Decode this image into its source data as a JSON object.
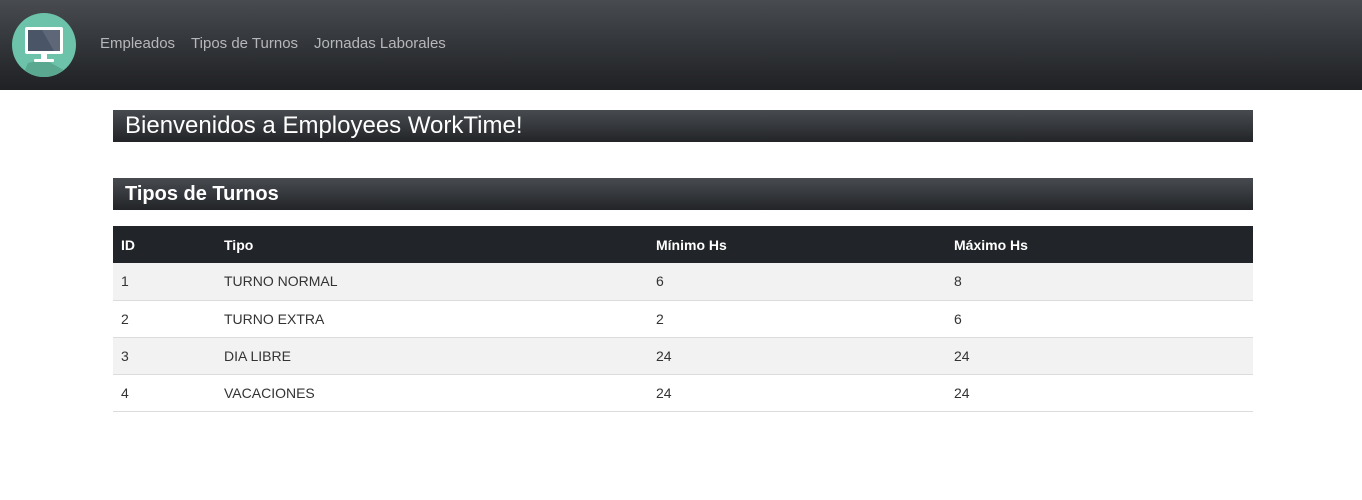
{
  "navbar": {
    "logo_icon": "monitor-icon",
    "links": [
      "Empleados",
      "Tipos de Turnos",
      "Jornadas Laborales"
    ]
  },
  "welcome": {
    "title": "Bienvenidos a Employees WorkTime!"
  },
  "section": {
    "title": "Tipos de Turnos"
  },
  "table": {
    "headers": [
      "ID",
      "Tipo",
      "Mínimo Hs",
      "Máximo Hs"
    ],
    "rows": [
      [
        "1",
        "TURNO NORMAL",
        "6",
        "8"
      ],
      [
        "2",
        "TURNO EXTRA",
        "2",
        "6"
      ],
      [
        "3",
        "DIA LIBRE",
        "24",
        "24"
      ],
      [
        "4",
        "VACACIONES",
        "24",
        "24"
      ]
    ]
  },
  "colors": {
    "navbar": "#34373b",
    "logo_bg": "#6cc3a9",
    "header_row": "#212428",
    "striped_row": "#f2f2f2"
  }
}
